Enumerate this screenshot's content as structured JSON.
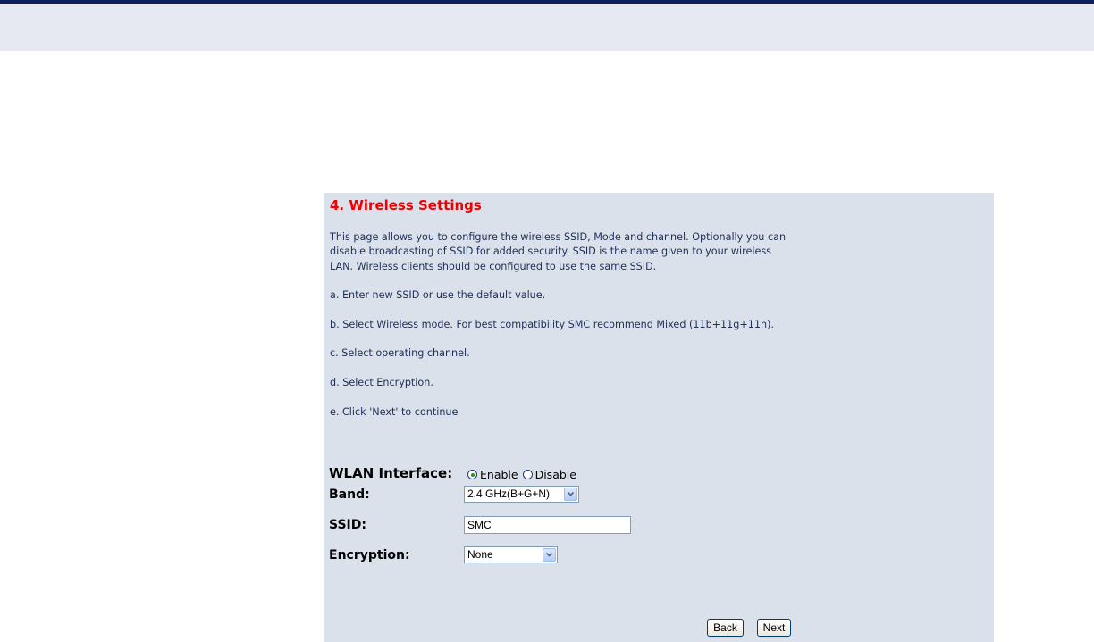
{
  "page": {
    "title": "4. Wireless Settings",
    "description": [
      "This page allows you to configure the wireless SSID, Mode and channel. Optionally you can disable broadcasting of SSID for added security. SSID is the name given to your wireless LAN. Wireless clients should be configured to use the same SSID.",
      "a. Enter new SSID or use the default value.",
      "b. Select Wireless mode. For best compatibility SMC recommend Mixed (11b+11g+11n).",
      "c. Select operating channel.",
      "d. Select Encryption.",
      "e. Click 'Next' to continue"
    ]
  },
  "form": {
    "wlan_interface": {
      "label": "WLAN Interface:",
      "options": [
        "Enable",
        "Disable"
      ],
      "selected": "Enable"
    },
    "band": {
      "label": "Band:",
      "value": "2.4 GHz(B+G+N)"
    },
    "ssid": {
      "label": "SSID:",
      "value": "SMC"
    },
    "encryption": {
      "label": "Encryption:",
      "value": "None"
    }
  },
  "buttons": {
    "back": "Back",
    "next": "Next"
  },
  "colors": {
    "top_bar": "#0a1f5c",
    "header_band": "#e6e9f1",
    "panel": "#dbe1ea",
    "title": "#ee0000",
    "body_text": "#1e2f57"
  },
  "icons": {
    "select_arrow": "chevron-down-icon"
  }
}
